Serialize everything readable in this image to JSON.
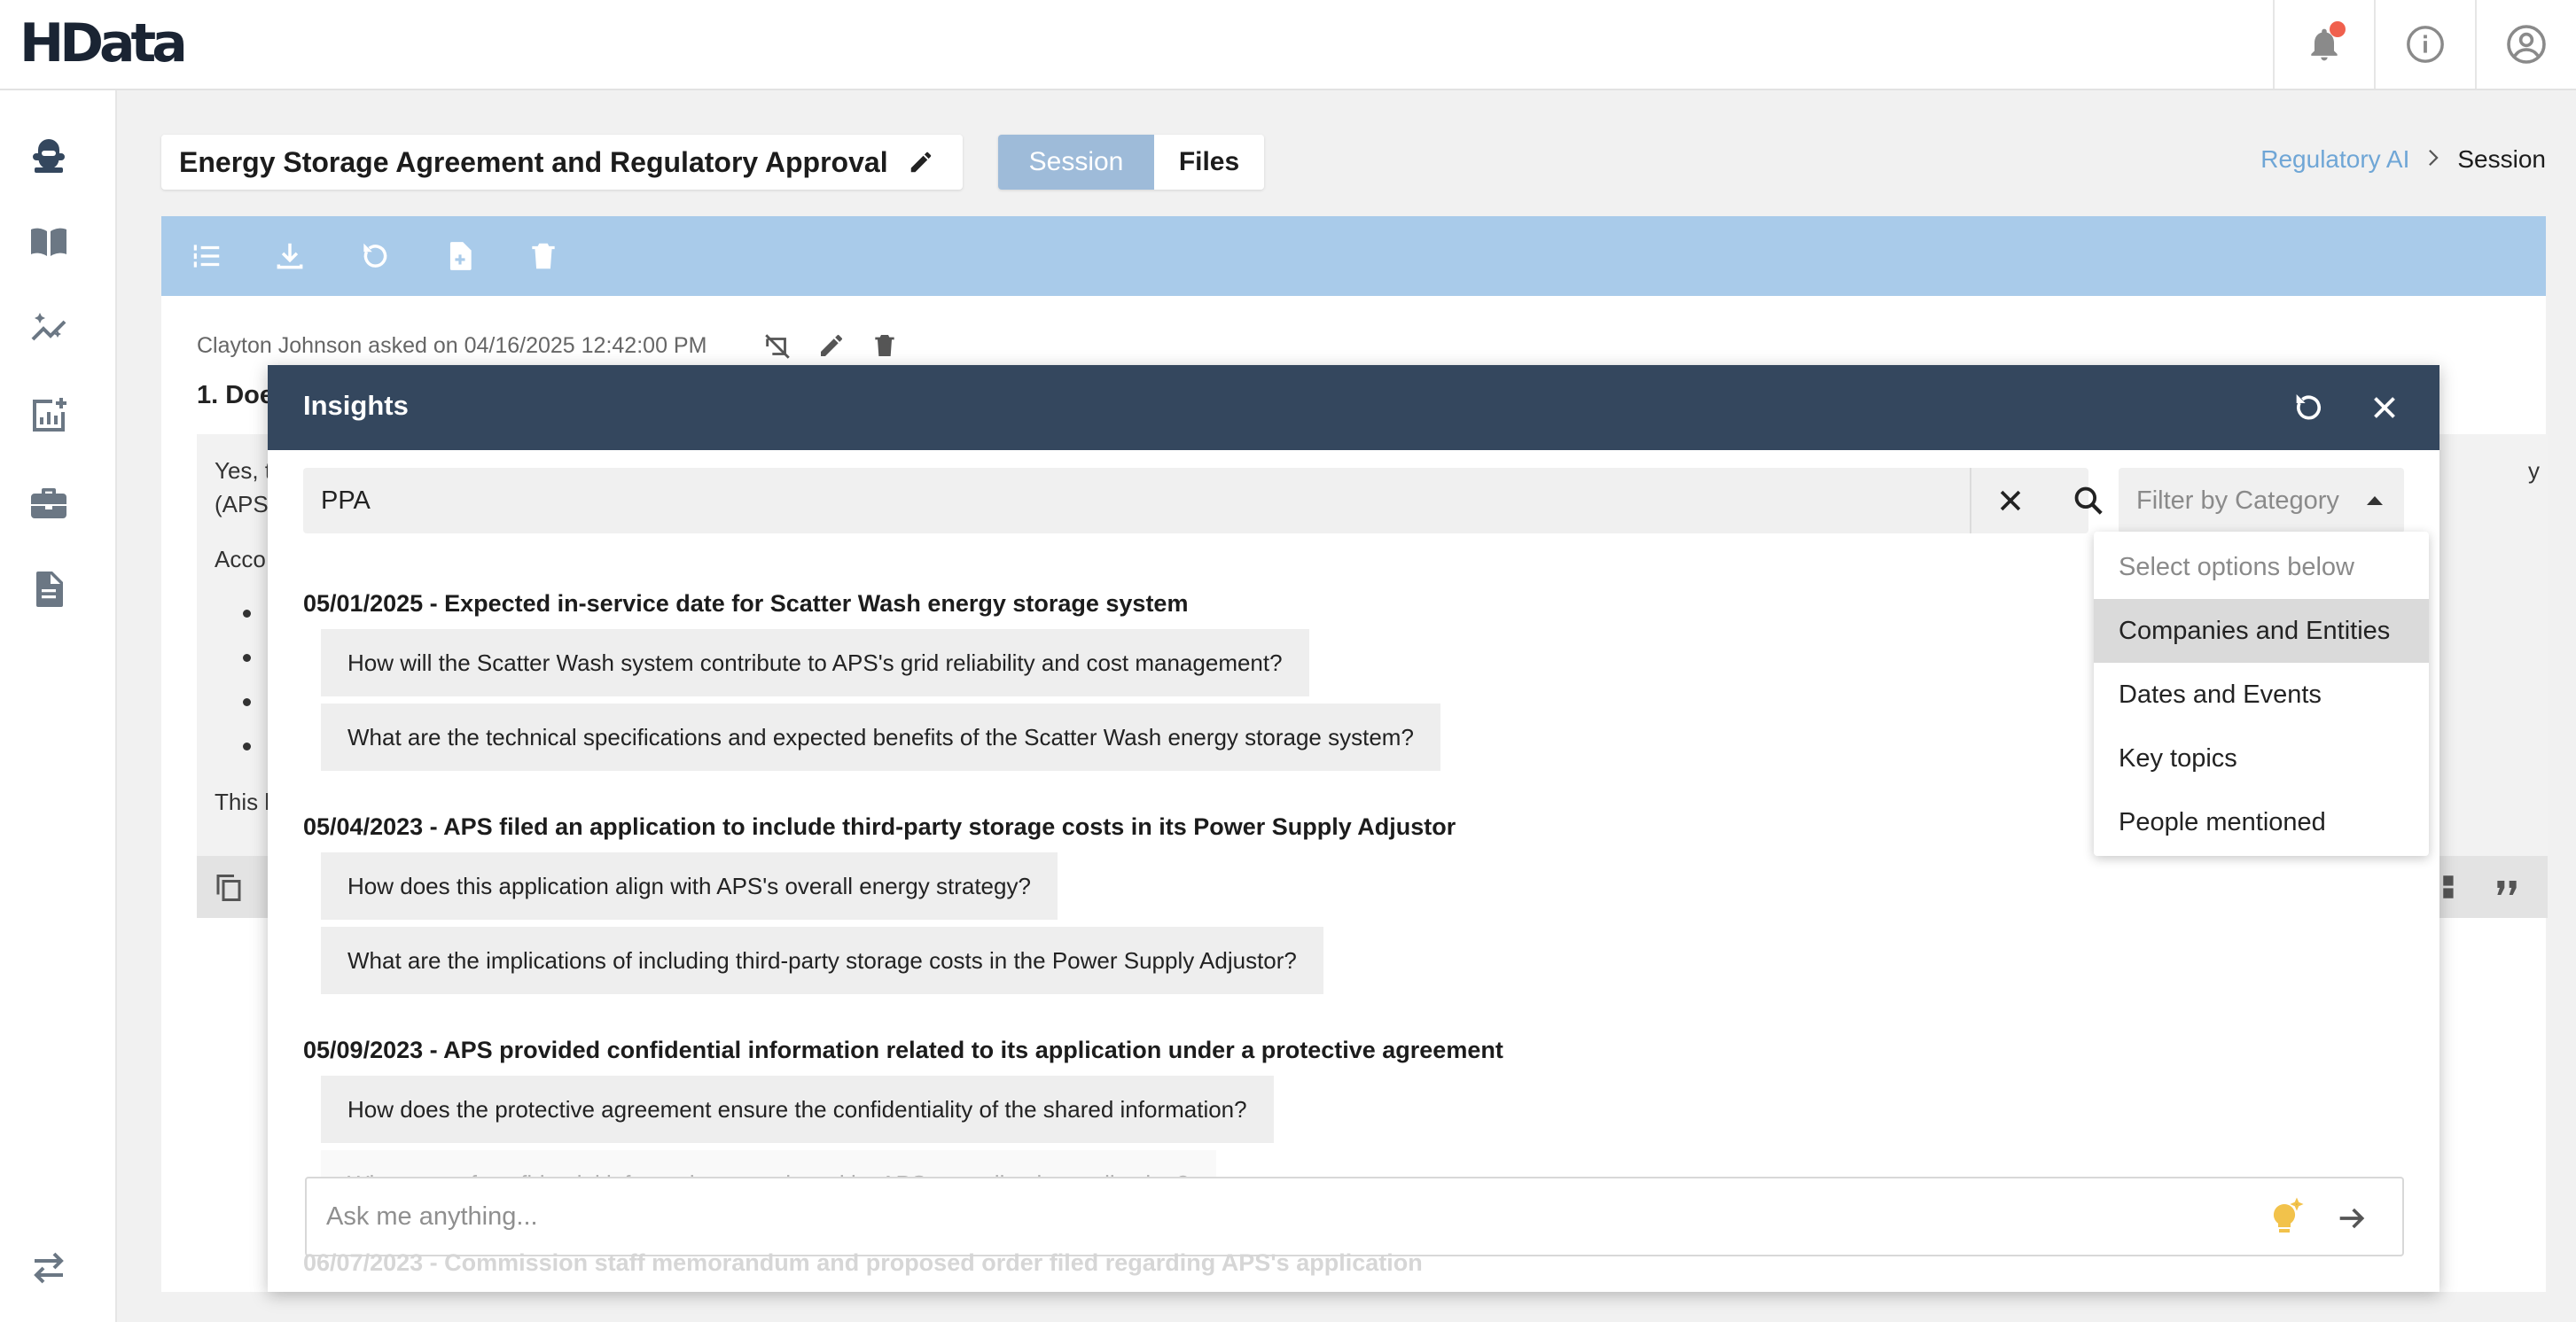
{
  "brand": {
    "logo_text": "HData"
  },
  "topbar": {
    "icons": [
      "bell-icon",
      "info-icon",
      "account-icon"
    ],
    "notification_color": "#f0604d"
  },
  "sidebar": {
    "icons": [
      "ai-assistant-icon",
      "library-book-icon",
      "insights-sparkle-icon",
      "add-chart-icon",
      "briefcase-icon",
      "document-icon",
      "swap-arrows-icon"
    ]
  },
  "header": {
    "title": "Energy Storage Agreement and Regulatory Approval",
    "tabs": [
      {
        "label": "Session",
        "active": true
      },
      {
        "label": "Files",
        "active": false
      }
    ],
    "breadcrumb": {
      "parent": "Regulatory AI",
      "current": "Session"
    }
  },
  "toolbar": {
    "icons": [
      "list-numbered-icon",
      "download-icon",
      "refresh-icon",
      "new-file-icon",
      "trash-icon"
    ],
    "color": "#a9cbea"
  },
  "conversation": {
    "asked_by": "Clayton Johnson asked on 04/16/2025 12:42:00 PM",
    "question_partial": "1. Doe",
    "answer_line1_start": "Yes, t",
    "answer_line1_end": "y",
    "answer_line2": "(APS",
    "answer_line3": "Acco",
    "answer_closing": "This l"
  },
  "insights": {
    "title": "Insights",
    "search_value": "PPA",
    "filter_placeholder": "Filter by Category",
    "events": [
      {
        "title": "05/01/2025 - Expected in-service date for Scatter Wash energy storage system",
        "questions": [
          "How will the Scatter Wash system contribute to APS's grid reliability and cost management?",
          "What are the technical specifications and expected benefits of the Scatter Wash energy storage system?"
        ]
      },
      {
        "title": "05/04/2023 - APS filed an application to include third-party storage costs in its Power Supply Adjustor",
        "questions": [
          "How does this application align with APS's overall energy strategy?",
          "What are the implications of including third-party storage costs in the Power Supply Adjustor?"
        ]
      },
      {
        "title": "05/09/2023 - APS provided confidential information related to its application under a protective agreement",
        "questions": [
          "How does the protective agreement ensure the confidentiality of the shared information?",
          "What type of confidential information was shared by APS regarding its application?"
        ]
      },
      {
        "title": "06/07/2023 - Commission staff memorandum and proposed order filed regarding APS's application",
        "questions": []
      }
    ],
    "ask_placeholder": "Ask me anything..."
  },
  "filter_dropdown": {
    "header": "Select options below",
    "options": [
      "Companies and Entities",
      "Dates and Events",
      "Key topics",
      "People mentioned"
    ],
    "highlighted": "Companies and Entities"
  },
  "colors": {
    "modal_header": "#34475e",
    "accent_link": "#6fa6d6",
    "tab_active": "#9ebbd9",
    "idea_bulb": "#f2c24b"
  }
}
